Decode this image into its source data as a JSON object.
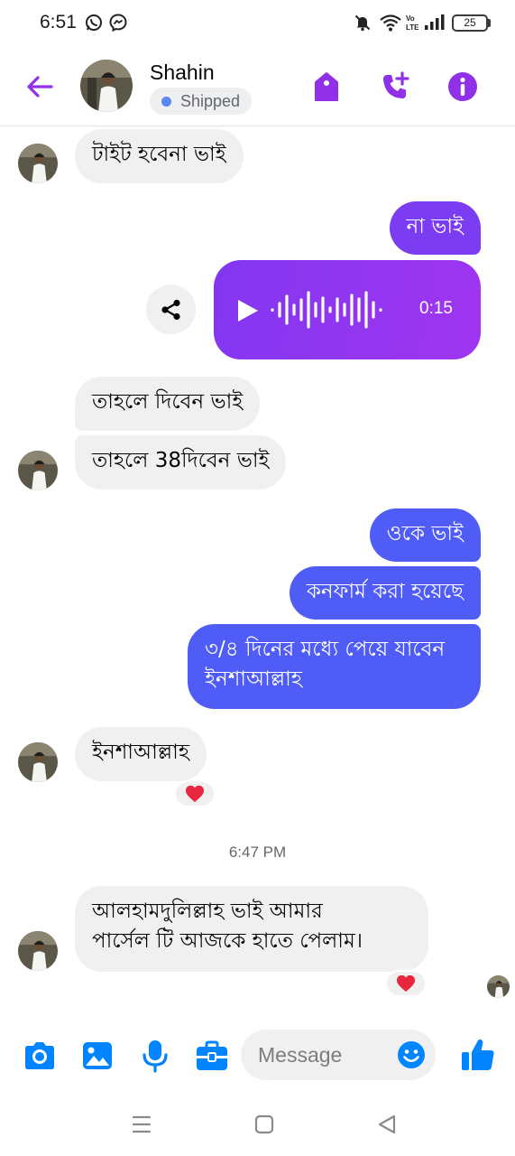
{
  "status_bar": {
    "time": "6:51",
    "battery": "25",
    "left_icons": [
      "whatsapp-icon",
      "messenger-icon"
    ],
    "right_icons": [
      "mute-bell-icon",
      "wifi-icon",
      "volte-icon",
      "signal-icon",
      "battery-icon"
    ]
  },
  "header": {
    "contact_name": "Shahin",
    "order_status": "Shipped",
    "actions": [
      "order-tag-icon",
      "add-call-icon",
      "info-icon"
    ],
    "accent_color": "#9030e8"
  },
  "messages": [
    {
      "direction": "in",
      "text": "টাইট হবেনা ভাই"
    },
    {
      "direction": "out",
      "text": "না ভাই"
    },
    {
      "direction": "out",
      "type": "voice",
      "duration": "0:15"
    },
    {
      "direction": "in",
      "text": "তাহলে দিবেন ভাই"
    },
    {
      "direction": "in",
      "text": "তাহলে 38দিবেন ভাই"
    },
    {
      "direction": "out",
      "text": "ওকে ভাই"
    },
    {
      "direction": "out",
      "text": "কনফার্ম করা হয়েছে"
    },
    {
      "direction": "out",
      "text_lines": [
        "৩/৪ দিনের মধ্যে পেয়ে যাবেন",
        "ইনশাআল্লাহ"
      ]
    },
    {
      "direction": "in",
      "text": "ইনশাআল্লাহ",
      "reaction": "heart"
    },
    {
      "type": "timestamp",
      "text": "6:47 PM"
    },
    {
      "direction": "in",
      "text_lines": [
        "আলহামদুলিল্লাহ ভাই আমার",
        "পার্সেল টি আজকে হাতে পেলাম।"
      ],
      "reaction": "heart"
    }
  ],
  "composer": {
    "placeholder": "Message",
    "tools": [
      "camera-icon",
      "gallery-icon",
      "mic-icon",
      "briefcase-icon"
    ],
    "accent_color": "#0084ff"
  },
  "colors": {
    "outgoing_blue": "#4f5cf6",
    "outgoing_purple": "#7c3cf2",
    "incoming_bg": "#f0f0f0",
    "heart": "#e8263d"
  }
}
